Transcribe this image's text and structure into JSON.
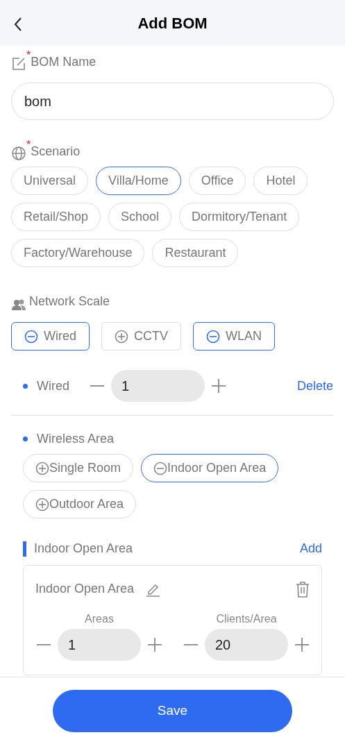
{
  "header": {
    "title": "Add BOM"
  },
  "bom_name": {
    "label": "BOM Name",
    "required_mark": "*",
    "value": "bom"
  },
  "scenario": {
    "label": "Scenario",
    "required_mark": "*",
    "options": [
      {
        "label": "Universal",
        "selected": false
      },
      {
        "label": "Villa/Home",
        "selected": true
      },
      {
        "label": "Office",
        "selected": false
      },
      {
        "label": "Hotel",
        "selected": false
      },
      {
        "label": "Retail/Shop",
        "selected": false
      },
      {
        "label": "School",
        "selected": false
      },
      {
        "label": "Dormitory/Tenant",
        "selected": false
      },
      {
        "label": "Factory/Warehouse",
        "selected": false
      },
      {
        "label": "Restaurant",
        "selected": false
      }
    ]
  },
  "network_scale": {
    "label": "Network Scale",
    "options": [
      {
        "label": "Wired",
        "selected": true
      },
      {
        "label": "CCTV",
        "selected": false
      },
      {
        "label": "WLAN",
        "selected": true
      }
    ]
  },
  "wired": {
    "label": "Wired",
    "value": "1",
    "delete": "Delete"
  },
  "wireless_area": {
    "label": "Wireless Area",
    "options": [
      {
        "label": "Single Room",
        "selected": false
      },
      {
        "label": "Indoor Open Area",
        "selected": true
      },
      {
        "label": "Outdoor Area",
        "selected": false
      }
    ]
  },
  "area_sections": [
    {
      "title": "Indoor Open Area",
      "add": "Add",
      "cards": [
        {
          "name": "Indoor Open Area",
          "fields": [
            {
              "label": "Areas",
              "value": "1"
            },
            {
              "label": "Clients/Area",
              "value": "20"
            }
          ]
        }
      ]
    }
  ],
  "save_button": "Save"
}
